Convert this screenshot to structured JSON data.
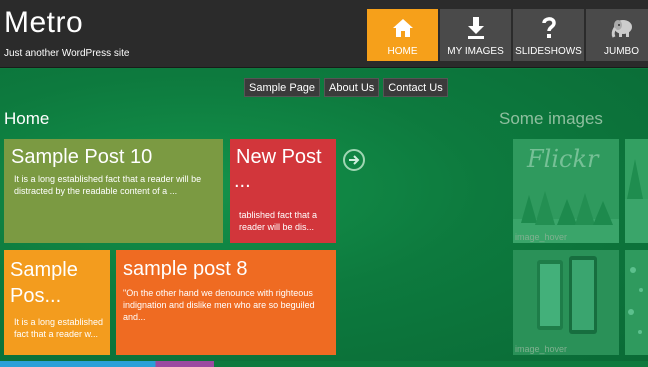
{
  "site": {
    "title": "Metro",
    "description": "Just another WordPress site"
  },
  "nav": [
    {
      "label": "HOME",
      "icon": "home-icon",
      "active": true
    },
    {
      "label": "MY IMAGES",
      "icon": "download-icon",
      "active": false
    },
    {
      "label": "SLIDESHOWS",
      "icon": "question-icon",
      "active": false
    },
    {
      "label": "JUMBO",
      "icon": "elephant-icon",
      "active": false
    }
  ],
  "page_menu": [
    "Sample Page",
    "About Us",
    "Contact Us"
  ],
  "sections": {
    "home": "Home",
    "images": "Some images"
  },
  "posts": [
    {
      "title": "Sample Post 10",
      "excerpt": "It is a long established fact that a reader will be distracted by the readable content of a ...",
      "color": "#7b9a42"
    },
    {
      "title": "New Post",
      "title_more": "...",
      "excerpt": "tablished fact that a reader will be dis...",
      "color": "#d2363b"
    },
    {
      "title": "Sample",
      "title_more": "Pos...",
      "excerpt": "It is a long established fact that a reader w...",
      "color": "#f39c1e"
    },
    {
      "title": "sample post 8",
      "excerpt": "\"On the other hand we denounce with righteous indignation and dislike men who are so beguiled and...",
      "color": "#ef6b22"
    }
  ],
  "gallery": {
    "flickr_text": "Flickr",
    "caption": "image_hover"
  },
  "colors": {
    "header_bg": "#2b2b2b",
    "accent": "#f6a01a",
    "background": "#0d7a3e"
  }
}
